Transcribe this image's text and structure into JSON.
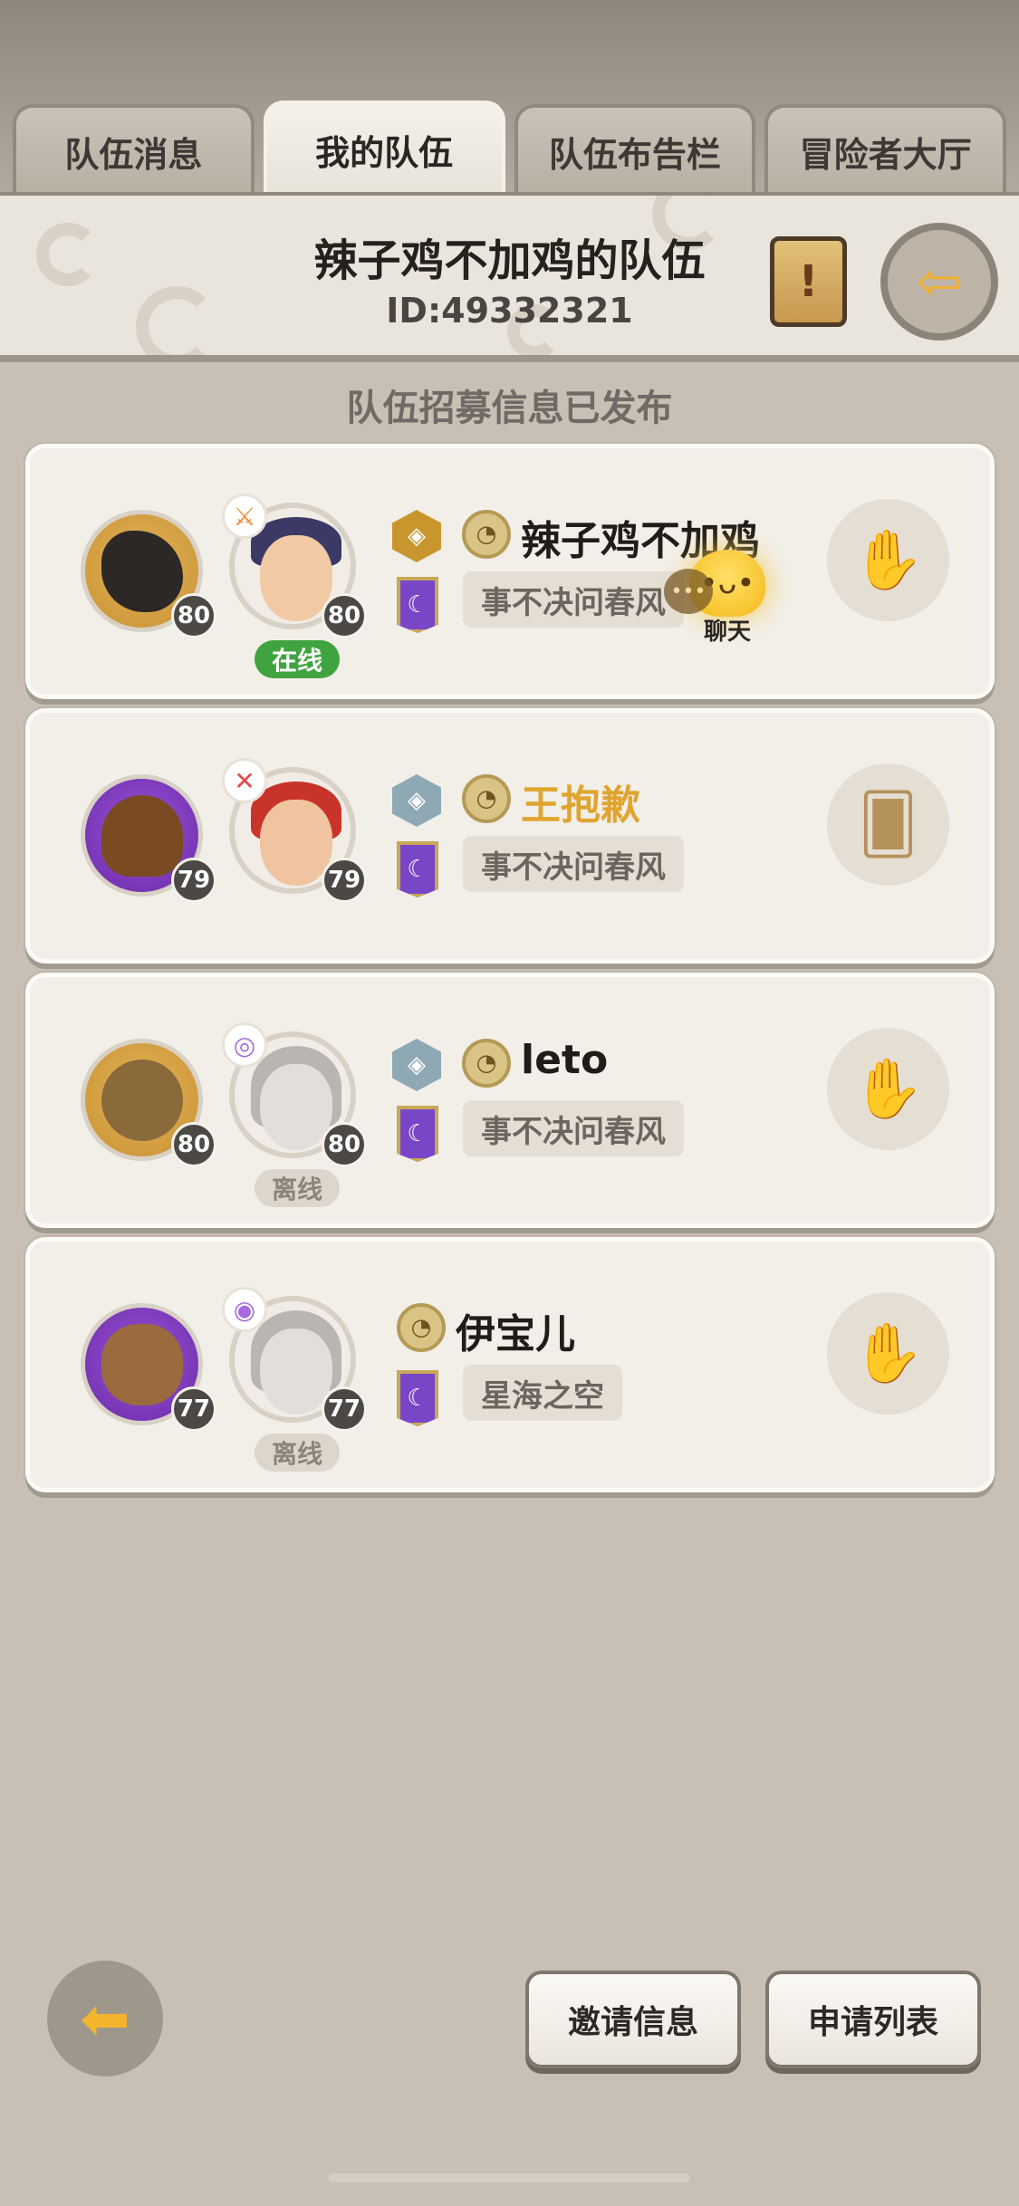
{
  "tabs": [
    {
      "label": "队伍消息",
      "active": false
    },
    {
      "label": "我的队伍",
      "active": true
    },
    {
      "label": "队伍布告栏",
      "active": false
    },
    {
      "label": "冒险者大厅",
      "active": false
    }
  ],
  "header": {
    "team_name": "辣子鸡不加鸡的队伍",
    "team_id": "ID:49332321",
    "scroll_icon_glyph": "!",
    "exit_icon_glyph": "⇦"
  },
  "recruit_notice": "队伍招募信息已发布",
  "chat_bubble": {
    "label": "聊天",
    "face": "•ᴗ•",
    "dots": "•••"
  },
  "members": [
    {
      "name": "辣子鸡不加鸡",
      "name_color": "#1f1c19",
      "pet_level": "80",
      "char_level": "80",
      "status": "在线",
      "guild": "事不决问春风",
      "rank": "gold",
      "class_color": "#f08a2a",
      "class_glyph": "⚔",
      "action_icon": "hand-wave-icon"
    },
    {
      "name": "王抱歉",
      "name_color": "#e0a530",
      "pet_level": "79",
      "char_level": "79",
      "status": "",
      "guild": "事不决问春风",
      "rank": "silver",
      "class_color": "#e04a4a",
      "class_glyph": "✕",
      "action_icon": "card-hand-icon"
    },
    {
      "name": "leto",
      "name_color": "#1f1c19",
      "pet_level": "80",
      "char_level": "80",
      "status": "离线",
      "guild": "事不决问春风",
      "rank": "silver",
      "class_color": "#a66be0",
      "class_glyph": "◎",
      "action_icon": "hand-wave-icon"
    },
    {
      "name": "伊宝儿",
      "name_color": "#1f1c19",
      "pet_level": "77",
      "char_level": "77",
      "status": "离线",
      "guild": "星海之空",
      "rank": "none",
      "class_color": "#a66be0",
      "class_glyph": "◉",
      "action_icon": "hand-wave-icon"
    }
  ],
  "bottom": {
    "back_glyph": "⬅",
    "invite_label": "邀请信息",
    "apply_label": "申请列表"
  }
}
